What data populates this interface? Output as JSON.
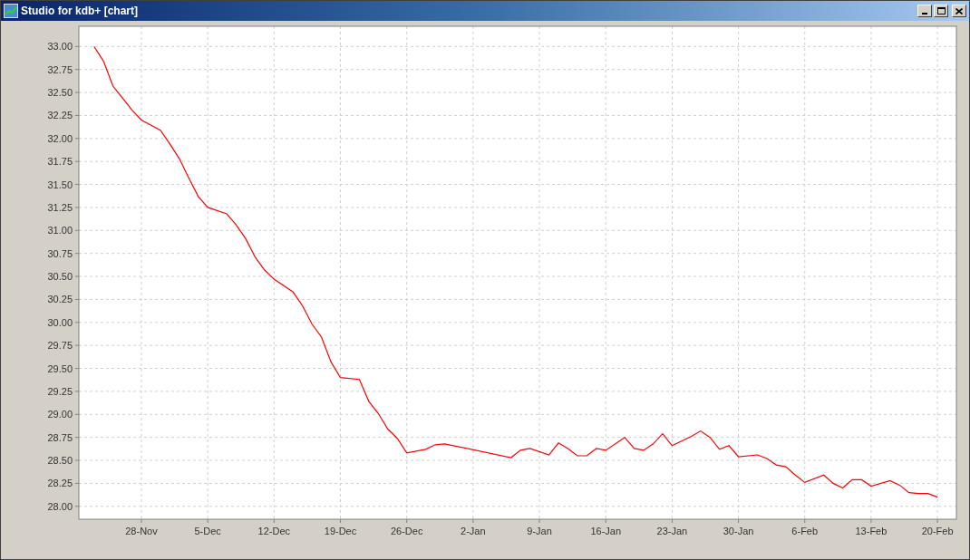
{
  "window": {
    "title": "Studio for kdb+ [chart]"
  },
  "chart_data": {
    "type": "line",
    "grid": true,
    "ylim": [
      27.86,
      33.22
    ],
    "categories": [
      null,
      null,
      null,
      null,
      null,
      "28-Nov",
      null,
      null,
      null,
      null,
      null,
      null,
      "5-Dec",
      null,
      null,
      null,
      null,
      null,
      null,
      "12-Dec",
      null,
      null,
      null,
      null,
      null,
      null,
      "19-Dec",
      null,
      null,
      null,
      null,
      null,
      null,
      "26-Dec",
      null,
      null,
      null,
      null,
      null,
      null,
      "2-Jan",
      null,
      null,
      null,
      null,
      null,
      null,
      "9-Jan",
      null,
      null,
      null,
      null,
      null,
      null,
      "16-Jan",
      null,
      null,
      null,
      null,
      null,
      null,
      "23-Jan",
      null,
      null,
      null,
      null,
      null,
      null,
      "30-Jan",
      null,
      null,
      null,
      null,
      null,
      null,
      "6-Feb",
      null,
      null,
      null,
      null,
      null,
      null,
      "13-Feb",
      null,
      null,
      null,
      null,
      null,
      null,
      "20-Feb"
    ],
    "yticks": [
      {
        "value": 28,
        "label": "28.00"
      },
      {
        "value": 28.25,
        "label": "28.25"
      },
      {
        "value": 28.5,
        "label": "28.50"
      },
      {
        "value": 28.75,
        "label": "28.75"
      },
      {
        "value": 29,
        "label": "29.00"
      },
      {
        "value": 29.25,
        "label": "29.25"
      },
      {
        "value": 29.5,
        "label": "29.50"
      },
      {
        "value": 29.75,
        "label": "29.75"
      },
      {
        "value": 30,
        "label": "30.00"
      },
      {
        "value": 30.25,
        "label": "30.25"
      },
      {
        "value": 30.5,
        "label": "30.50"
      },
      {
        "value": 30.75,
        "label": "30.75"
      },
      {
        "value": 31,
        "label": "31.00"
      },
      {
        "value": 31.25,
        "label": "31.25"
      },
      {
        "value": 31.5,
        "label": "31.50"
      },
      {
        "value": 31.75,
        "label": "31.75"
      },
      {
        "value": 32,
        "label": "32.00"
      },
      {
        "value": 32.25,
        "label": "32.25"
      },
      {
        "value": 32.5,
        "label": "32.50"
      },
      {
        "value": 32.75,
        "label": "32.75"
      },
      {
        "value": 33,
        "label": "33.00"
      }
    ],
    "series": [
      {
        "color": "#ff0000",
        "values": [
          33.0,
          32.84,
          32.57,
          32.44,
          32.31,
          32.2,
          null,
          32.09,
          31.94,
          31.78,
          31.57,
          31.37,
          31.25,
          null,
          31.18,
          31.06,
          30.91,
          30.71,
          30.57,
          30.47,
          null,
          30.33,
          30.18,
          29.98,
          29.84,
          29.57,
          29.4,
          null,
          29.38,
          29.14,
          29.01,
          28.84,
          28.74,
          28.58,
          null,
          28.62,
          28.67,
          28.68,
          null,
          null,
          null,
          null,
          null,
          null,
          28.53,
          28.61,
          28.63,
          null,
          28.56,
          28.69,
          28.63,
          28.55,
          28.55,
          28.63,
          28.61,
          null,
          28.75,
          28.63,
          28.61,
          28.68,
          28.79,
          28.66,
          null,
          28.76,
          28.82,
          28.75,
          28.62,
          28.66,
          28.54,
          null,
          28.56,
          28.52,
          28.45,
          28.43,
          28.34,
          28.26,
          null,
          28.34,
          28.25,
          28.2,
          28.29,
          28.29,
          28.22,
          null,
          28.28,
          28.23,
          28.15,
          28.14,
          28.14,
          28.1
        ]
      }
    ]
  }
}
